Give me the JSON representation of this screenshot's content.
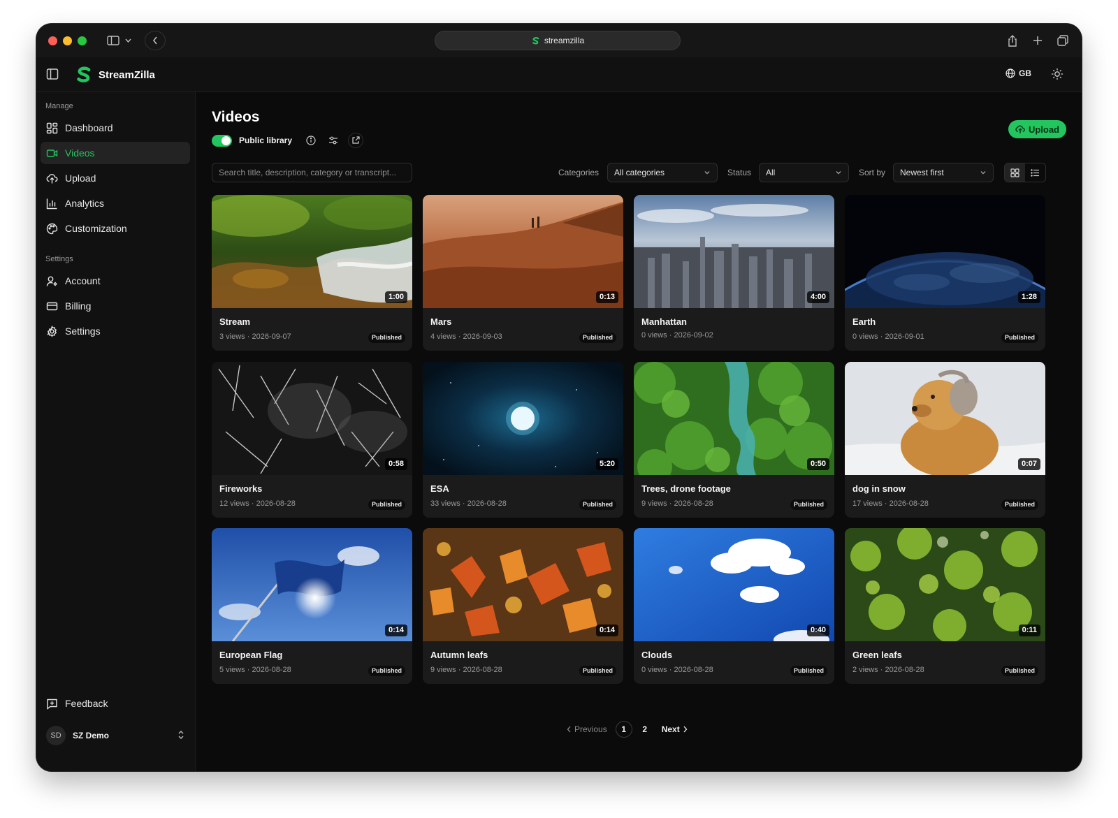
{
  "browser": {
    "url": "streamzilla"
  },
  "header": {
    "brand": "StreamZilla",
    "language": "GB"
  },
  "sidebar": {
    "manage_label": "Manage",
    "manage_items": [
      {
        "label": "Dashboard",
        "icon": "dashboard-icon"
      },
      {
        "label": "Videos",
        "icon": "video-icon",
        "active": true
      },
      {
        "label": "Upload",
        "icon": "cloud-upload-icon"
      },
      {
        "label": "Analytics",
        "icon": "bar-chart-icon"
      },
      {
        "label": "Customization",
        "icon": "palette-icon"
      }
    ],
    "settings_label": "Settings",
    "settings_items": [
      {
        "label": "Account",
        "icon": "user-icon"
      },
      {
        "label": "Billing",
        "icon": "credit-card-icon"
      },
      {
        "label": "Settings",
        "icon": "gear-icon"
      }
    ],
    "feedback_label": "Feedback",
    "user": {
      "initials": "SD",
      "name": "SZ Demo"
    }
  },
  "main": {
    "title": "Videos",
    "public_library_label": "Public library",
    "public_library_enabled": true,
    "upload_label": "Upload",
    "search_placeholder": "Search title, description, category or transcript...",
    "categories_label": "Categories",
    "categories_value": "All categories",
    "status_label": "Status",
    "status_value": "All",
    "sort_label": "Sort by",
    "sort_value": "Newest first",
    "view_mode": "grid",
    "videos": [
      {
        "title": "Stream",
        "views": "3 views",
        "date": "2026-09-07",
        "duration": "1:00",
        "status": "Published"
      },
      {
        "title": "Mars",
        "views": "4 views",
        "date": "2026-09-03",
        "duration": "0:13",
        "status": "Published"
      },
      {
        "title": "Manhattan",
        "views": "0 views",
        "date": "2026-09-02",
        "duration": "4:00",
        "status": ""
      },
      {
        "title": "Earth",
        "views": "0 views",
        "date": "2026-09-01",
        "duration": "1:28",
        "status": "Published"
      },
      {
        "title": "Fireworks",
        "views": "12 views",
        "date": "2026-08-28",
        "duration": "0:58",
        "status": "Published"
      },
      {
        "title": "ESA",
        "views": "33 views",
        "date": "2026-08-28",
        "duration": "5:20",
        "status": "Published"
      },
      {
        "title": "Trees, drone footage",
        "views": "9 views",
        "date": "2026-08-28",
        "duration": "0:50",
        "status": "Published"
      },
      {
        "title": "dog in snow",
        "views": "17 views",
        "date": "2026-08-28",
        "duration": "0:07",
        "status": "Published"
      },
      {
        "title": "European Flag",
        "views": "5 views",
        "date": "2026-08-28",
        "duration": "0:14",
        "status": "Published"
      },
      {
        "title": "Autumn leafs",
        "views": "9 views",
        "date": "2026-08-28",
        "duration": "0:14",
        "status": "Published"
      },
      {
        "title": "Clouds",
        "views": "0 views",
        "date": "2026-08-28",
        "duration": "0:40",
        "status": "Published"
      },
      {
        "title": "Green leafs",
        "views": "2 views",
        "date": "2026-08-28",
        "duration": "0:11",
        "status": "Published"
      }
    ],
    "pagination": {
      "previous": "Previous",
      "next": "Next",
      "pages": [
        "1",
        "2"
      ],
      "current": "1"
    }
  },
  "colors": {
    "accent": "#22c55e",
    "background": "#0b0b0b",
    "card": "#1b1b1b"
  }
}
